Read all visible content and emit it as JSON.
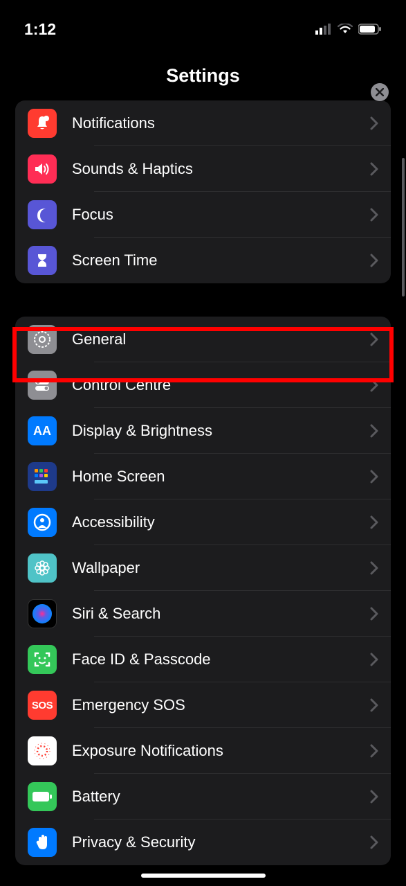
{
  "status": {
    "time": "1:12"
  },
  "header": {
    "title": "Settings"
  },
  "groups": [
    {
      "rows": [
        {
          "id": "notifications",
          "label": "Notifications",
          "icon": "bell-badge-icon",
          "bg": "bg-red"
        },
        {
          "id": "sounds",
          "label": "Sounds & Haptics",
          "icon": "speaker-icon",
          "bg": "bg-pink"
        },
        {
          "id": "focus",
          "label": "Focus",
          "icon": "moon-icon",
          "bg": "bg-indigo"
        },
        {
          "id": "screentime",
          "label": "Screen Time",
          "icon": "hourglass-icon",
          "bg": "bg-indigo"
        }
      ]
    },
    {
      "rows": [
        {
          "id": "general",
          "label": "General",
          "icon": "gear-icon",
          "bg": "bg-gray",
          "highlighted": true
        },
        {
          "id": "controlcentre",
          "label": "Control Centre",
          "icon": "toggles-icon",
          "bg": "bg-gray"
        },
        {
          "id": "display",
          "label": "Display & Brightness",
          "icon": "aa-icon",
          "bg": "bg-blue"
        },
        {
          "id": "homescreen",
          "label": "Home Screen",
          "icon": "grid-icon",
          "bg": "bg-darkblue"
        },
        {
          "id": "accessibility",
          "label": "Accessibility",
          "icon": "person-circle-icon",
          "bg": "bg-blue"
        },
        {
          "id": "wallpaper",
          "label": "Wallpaper",
          "icon": "flower-icon",
          "bg": "bg-teal"
        },
        {
          "id": "siri",
          "label": "Siri & Search",
          "icon": "siri-icon",
          "bg": "bg-black"
        },
        {
          "id": "faceid",
          "label": "Face ID & Passcode",
          "icon": "face-icon",
          "bg": "bg-green"
        },
        {
          "id": "sos",
          "label": "Emergency SOS",
          "icon": "sos-icon",
          "bg": "bg-red"
        },
        {
          "id": "exposure",
          "label": "Exposure Notifications",
          "icon": "virus-icon",
          "bg": "bg-white"
        },
        {
          "id": "battery",
          "label": "Battery",
          "icon": "battery-icon",
          "bg": "bg-green"
        },
        {
          "id": "privacy",
          "label": "Privacy & Security",
          "icon": "hand-icon",
          "bg": "bg-blue"
        }
      ]
    }
  ]
}
